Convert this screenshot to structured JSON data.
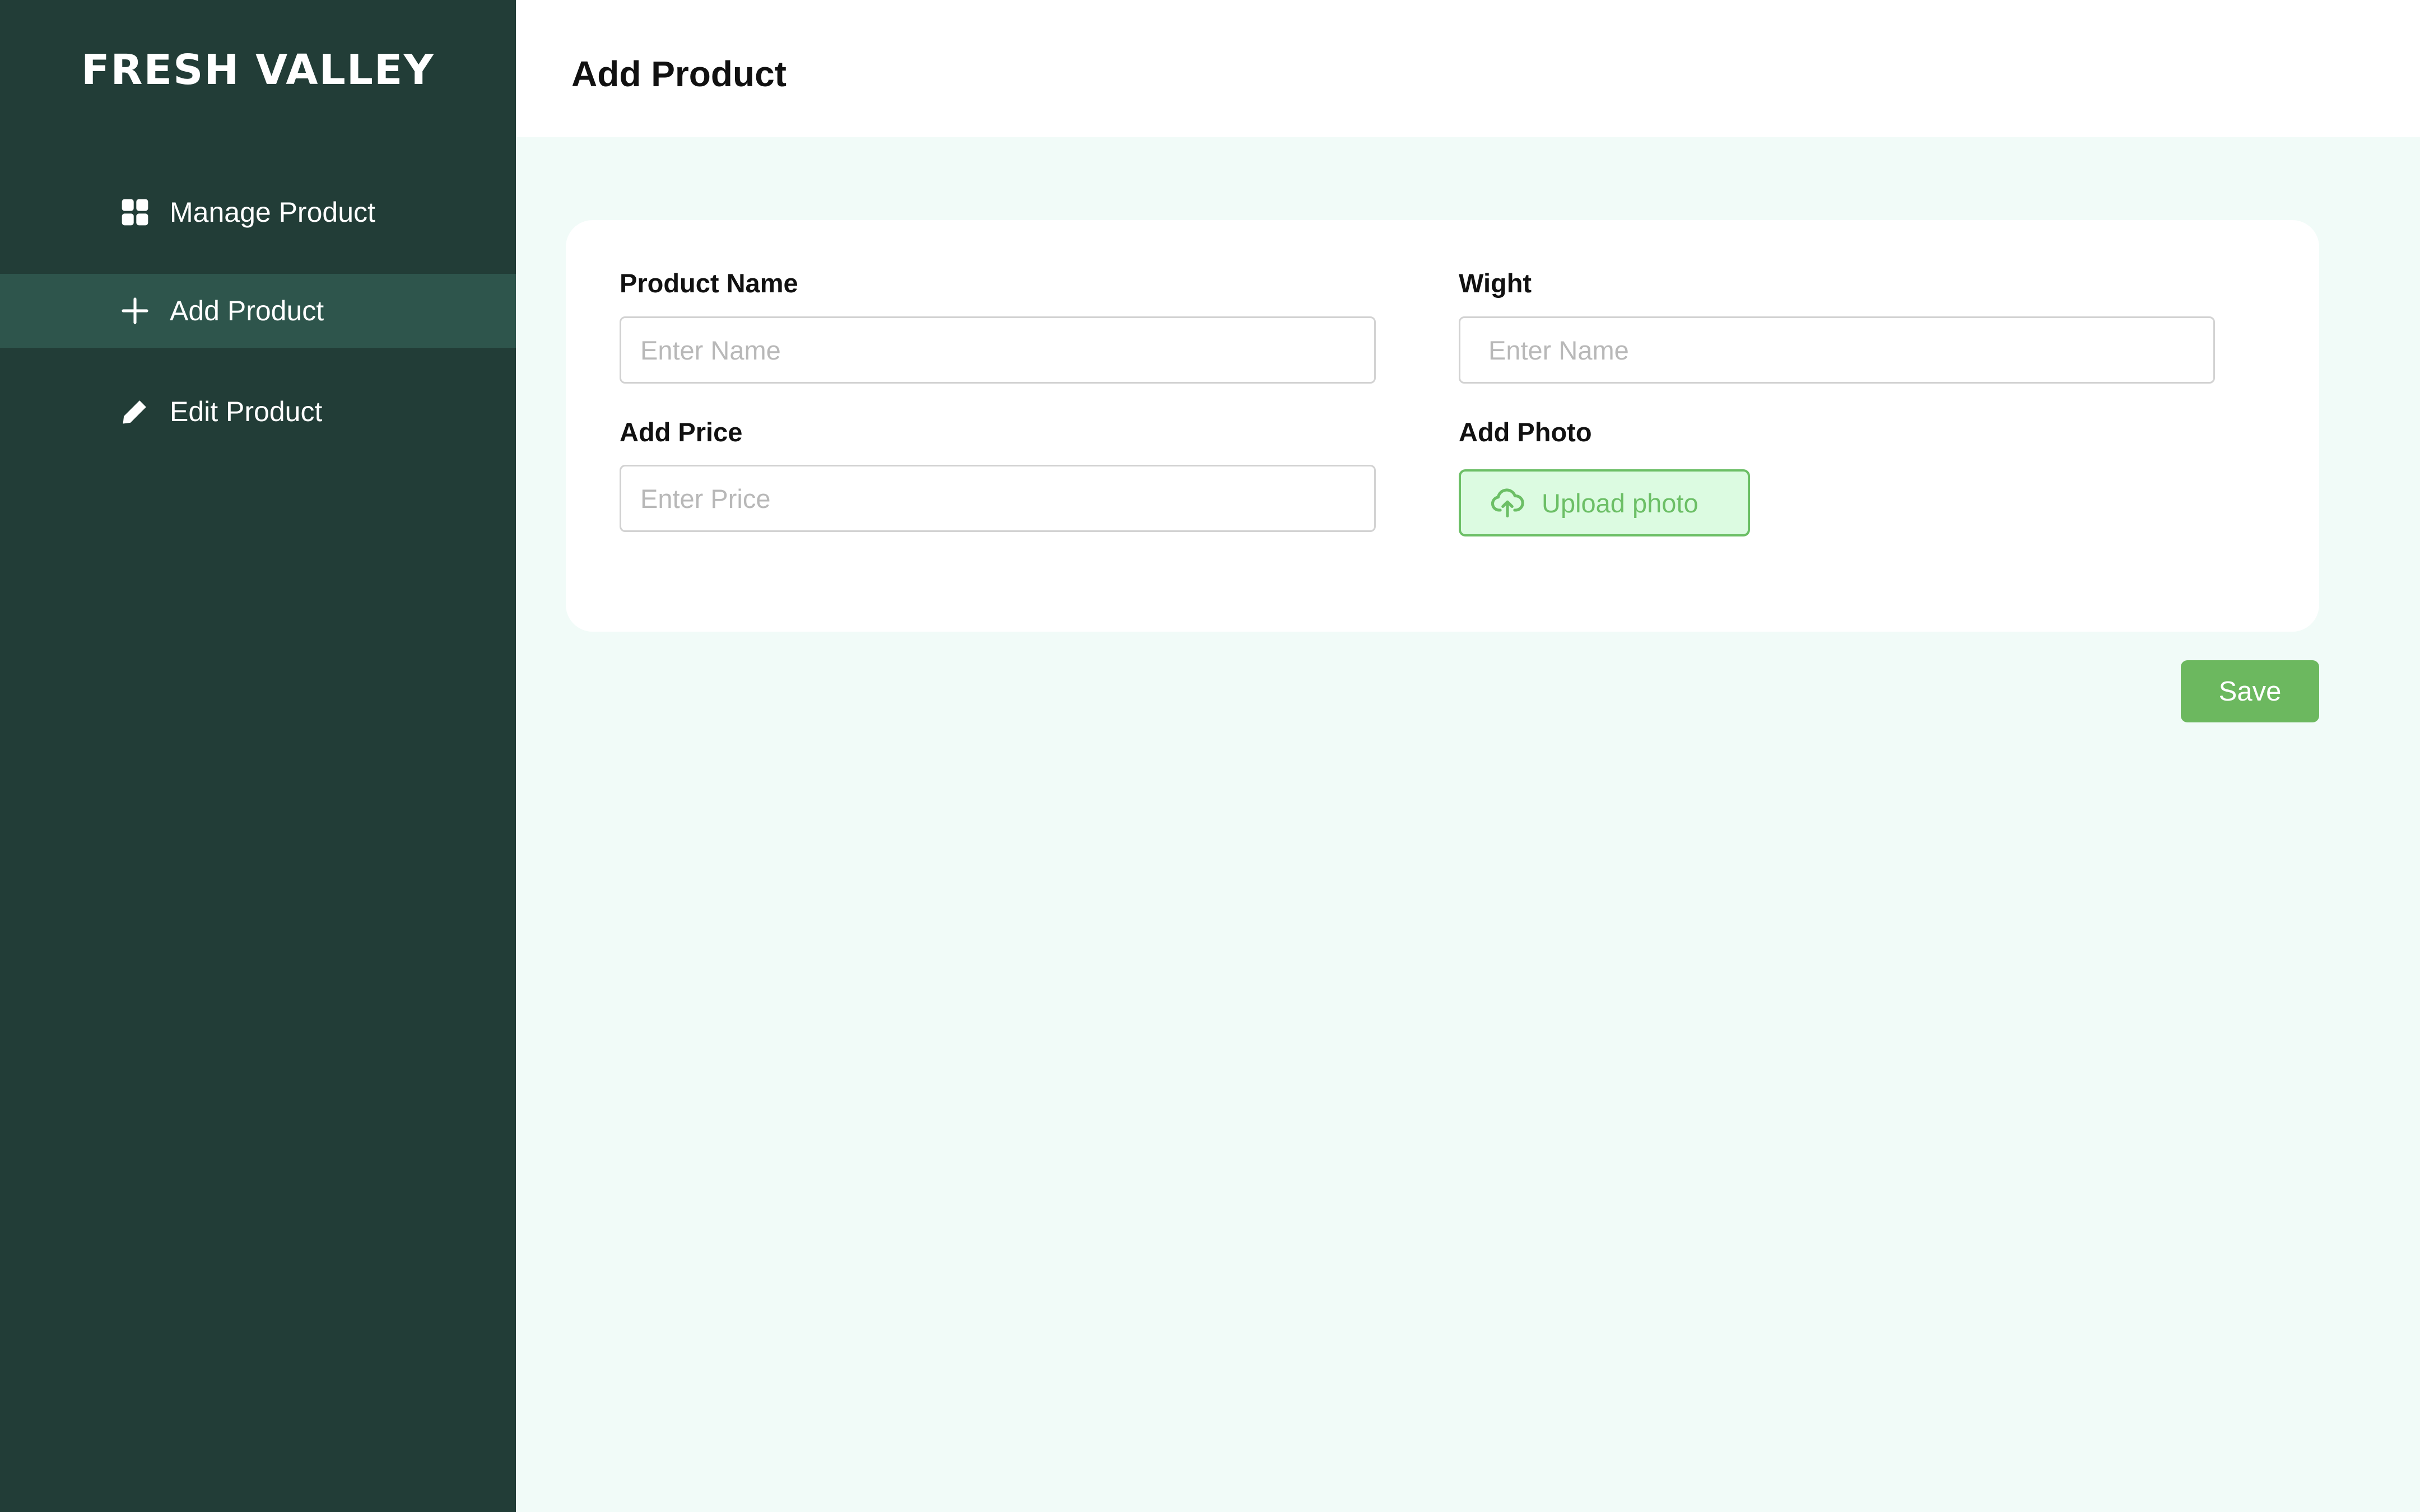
{
  "brand": {
    "name": "FRESH VALLEY"
  },
  "sidebar": {
    "items": [
      {
        "label": "Manage Product",
        "icon": "grid-icon",
        "active": false
      },
      {
        "label": "Add Product",
        "icon": "plus-icon",
        "active": true
      },
      {
        "label": "Edit Product",
        "icon": "pencil-icon",
        "active": false
      }
    ]
  },
  "header": {
    "title": "Add Product"
  },
  "form": {
    "product_name": {
      "label": "Product Name",
      "placeholder": "Enter Name",
      "value": ""
    },
    "weight": {
      "label": "Wight",
      "placeholder": "Enter Name",
      "value": ""
    },
    "price": {
      "label": "Add Price",
      "placeholder": "Enter Price",
      "value": ""
    },
    "photo": {
      "label": "Add Photo",
      "button_label": "Upload photo",
      "icon": "cloud-upload-icon"
    }
  },
  "actions": {
    "save_label": "Save"
  },
  "colors": {
    "sidebar_bg": "#223d37",
    "sidebar_active_bg": "#2e554c",
    "page_bg": "#f1fbf8",
    "accent_green": "#6cb85f",
    "upload_bg": "#dcfbe1"
  }
}
